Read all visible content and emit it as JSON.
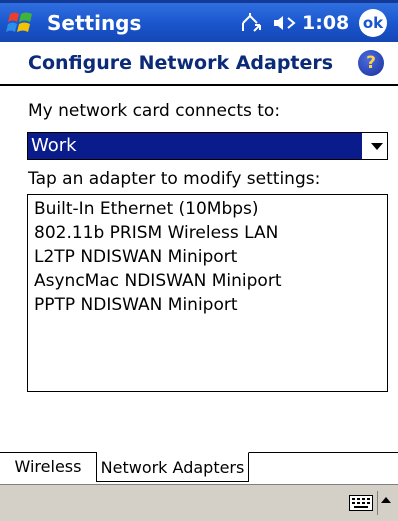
{
  "title_bar": {
    "app_title": "Settings",
    "time": "1:08",
    "ok_label": "ok",
    "icons": [
      "windows-start-icon",
      "connectivity-icon",
      "volume-icon"
    ]
  },
  "header": {
    "title": "Configure Network Adapters",
    "help_label": "?"
  },
  "main": {
    "connects_label": "My network card connects to:",
    "connects_value": "Work",
    "tap_label": "Tap an adapter to modify settings:",
    "adapters": [
      "Built-In Ethernet (10Mbps)",
      "802.11b PRISM Wireless LAN",
      "L2TP NDISWAN Miniport",
      "AsyncMac NDISWAN Miniport",
      "PPTP NDISWAN Miniport"
    ]
  },
  "tabs": [
    {
      "label": "Wireless",
      "active": false
    },
    {
      "label": "Network Adapters",
      "active": true
    }
  ],
  "menu_bar": {
    "icons": [
      "keyboard-icon",
      "sip-arrow-icon"
    ]
  },
  "colors": {
    "title_bar": "#1a55cc",
    "header_text": "#0b2a78",
    "selection": "#0a1c8c",
    "menu_bar": "#d4d0c8"
  }
}
